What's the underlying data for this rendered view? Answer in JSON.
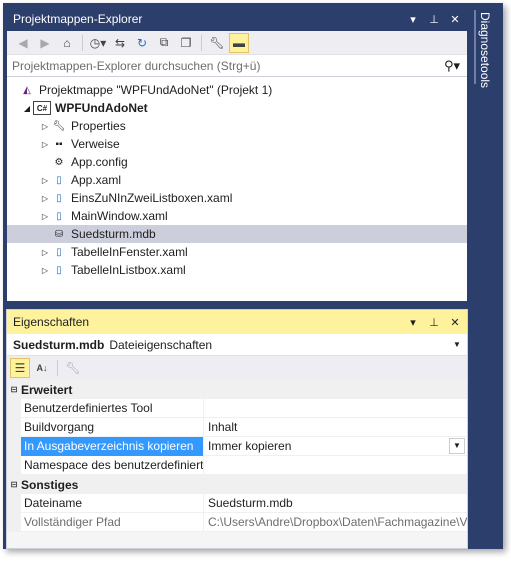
{
  "solution_explorer": {
    "title": "Projektmappen-Explorer",
    "search_placeholder": "Projektmappen-Explorer durchsuchen (Strg+ü)",
    "tree": {
      "solution": "Projektmappe \"WPFUndAdoNet\" (Projekt 1)",
      "project": "WPFUndAdoNet",
      "items": [
        "Properties",
        "Verweise",
        "App.config",
        "App.xaml",
        "EinsZuNInZweiListboxen.xaml",
        "MainWindow.xaml",
        "Suedsturm.mdb",
        "TabelleInFenster.xaml",
        "TabelleInListbox.xaml"
      ]
    }
  },
  "properties": {
    "title": "Eigenschaften",
    "object_name": "Suedsturm.mdb",
    "object_type": "Dateieigenschaften",
    "categories": {
      "advanced": "Erweitert",
      "misc": "Sonstiges"
    },
    "rows": {
      "custom_tool": {
        "name": "Benutzerdefiniertes Tool",
        "value": ""
      },
      "build_action": {
        "name": "Buildvorgang",
        "value": "Inhalt"
      },
      "copy_output": {
        "name": "In Ausgabeverzeichnis kopieren",
        "value": "Immer kopieren"
      },
      "namespace": {
        "name": "Namespace des benutzerdefiniert",
        "value": ""
      },
      "filename": {
        "name": "Dateiname",
        "value": "Suedsturm.mdb"
      },
      "full_path": {
        "name": "Vollständiger Pfad",
        "value": "C:\\Users\\Andre\\Dropbox\\Daten\\Fachmagazine\\V"
      }
    }
  },
  "side_tab": {
    "label": "Diagnosetools"
  },
  "colors": {
    "title_bg": "#2c3e6b",
    "active_title_bg": "#fff29d",
    "selection": "#cccedb",
    "property_selection": "#3399ff"
  }
}
